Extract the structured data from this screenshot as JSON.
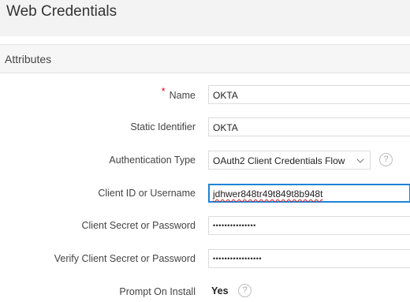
{
  "page": {
    "title": "Web Credentials"
  },
  "region": {
    "title": "Attributes"
  },
  "fields": {
    "name": {
      "required_marker": "*",
      "label": "Name",
      "value": "OKTA"
    },
    "static_id": {
      "label": "Static Identifier",
      "value": "OKTA"
    },
    "auth_type": {
      "label": "Authentication Type",
      "value": "OAuth2 Client Credentials Flow",
      "help": "?"
    },
    "client_id": {
      "label": "Client ID or Username",
      "value": "jdhwer848tr49t849t8b948t"
    },
    "client_secret": {
      "label": "Client Secret or Password",
      "value": "•••••••••••••••"
    },
    "verify_secret": {
      "label": "Verify Client Secret or Password",
      "value": "•••••••••••••••••"
    },
    "prompt_install": {
      "label": "Prompt On Install",
      "value": "Yes",
      "help": "?"
    }
  },
  "colors": {
    "required": "#e0001b",
    "focus": "#1e84d8",
    "header_bg": "#f3f3f3"
  }
}
